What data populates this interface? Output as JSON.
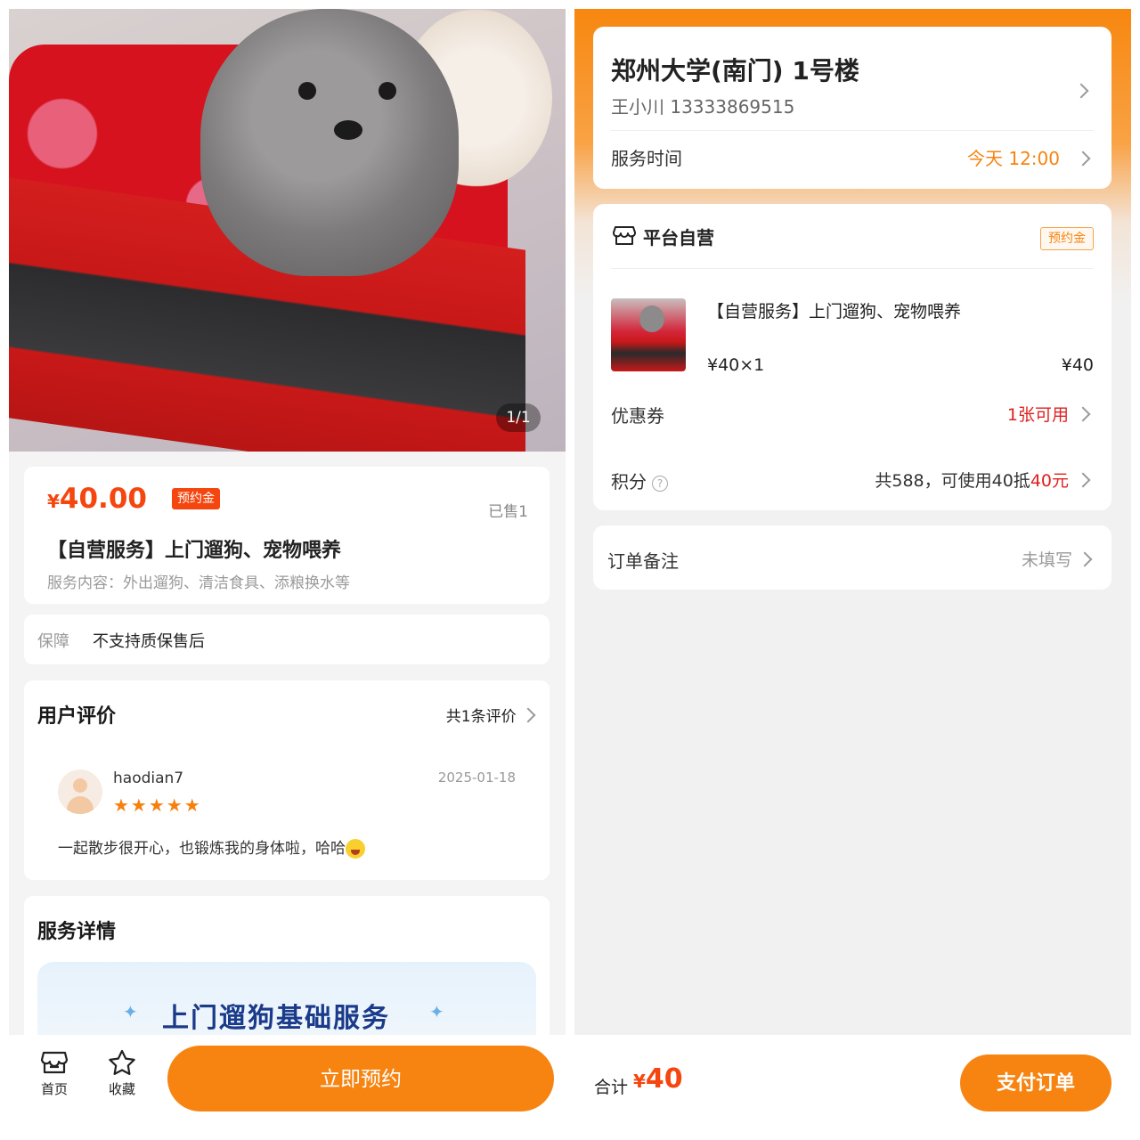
{
  "product_page": {
    "image_counter": "1/1",
    "price": {
      "currency": "¥",
      "amount": "40.00",
      "tag": "预约金"
    },
    "sold": "已售1",
    "title": "【自营服务】上门遛狗、宠物喂养",
    "description": "服务内容：外出遛狗、清洁食具、添粮换水等",
    "guarantee": {
      "label": "保障",
      "value": "不支持质保售后"
    },
    "reviews": {
      "heading": "用户评价",
      "count_label": "共1条评价",
      "items": [
        {
          "user": "haodian7",
          "date": "2025-01-18",
          "stars": "★★★★★",
          "rating": 5,
          "text": "一起散步很开心，也锻炼我的身体啦，哈哈"
        }
      ]
    },
    "details": {
      "heading": "服务详情",
      "banner_text": "上门遛狗基础服务"
    },
    "bottom_nav": {
      "home": "首页",
      "favorite": "收藏",
      "book_button": "立即预约"
    }
  },
  "order_page": {
    "address": "郑州大学(南门) 1号楼",
    "contact": "王小川   13333869515",
    "service_time": {
      "label": "服务时间",
      "value": "今天 12:00"
    },
    "shop": {
      "name": "平台自营",
      "tag": "预约金"
    },
    "item": {
      "title": "【自营服务】上门遛狗、宠物喂养",
      "unit_qty": "¥40×1",
      "total": "¥40"
    },
    "coupon": {
      "label": "优惠券",
      "value": "1张可用"
    },
    "points": {
      "label": "积分",
      "help": "?",
      "value_prefix": "共588，可使用40抵",
      "value_highlight": "40元"
    },
    "note": {
      "label": "订单备注",
      "value": "未填写"
    },
    "footer": {
      "total_label": "合计",
      "currency": "¥",
      "amount": "40",
      "pay_button": "支付订单"
    }
  },
  "colors": {
    "accent": "#f78410",
    "price": "#f5460f",
    "red": "#e02020"
  }
}
